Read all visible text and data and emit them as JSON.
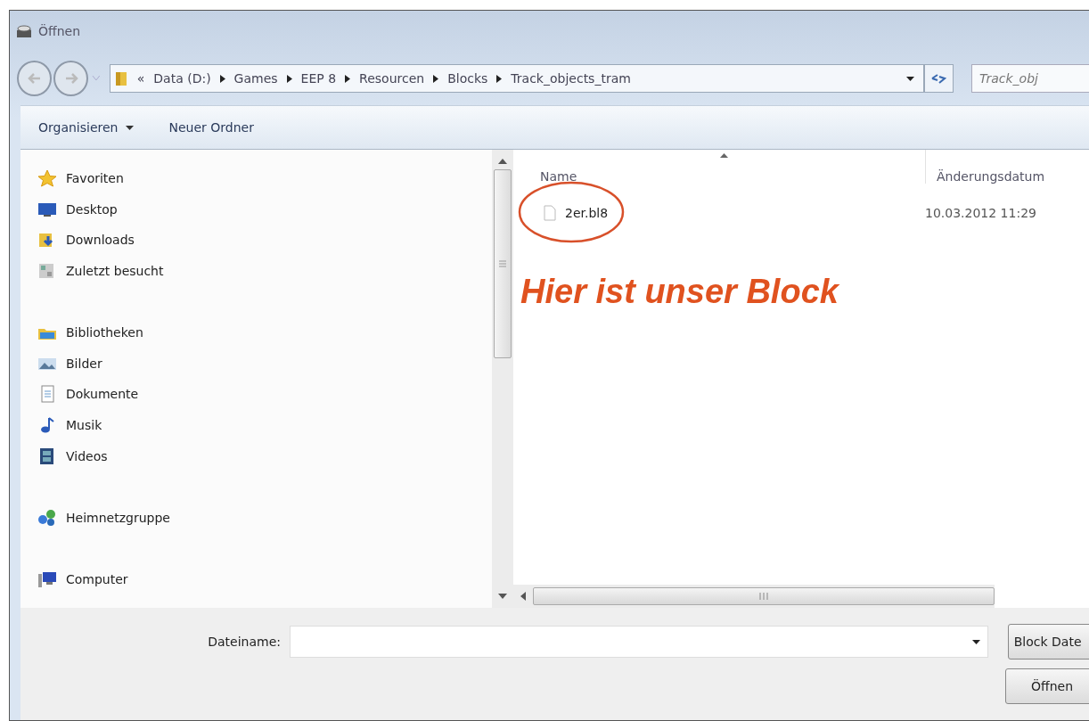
{
  "window": {
    "title": "Öffnen"
  },
  "breadcrumb": {
    "overflow": "«",
    "segments": [
      "Data (D:)",
      "Games",
      "EEP 8",
      "Resourcen",
      "Blocks",
      "Track_objects_tram"
    ]
  },
  "search": {
    "placeholder": "Track_obj"
  },
  "toolbar": [
    {
      "label": "Organisieren",
      "kind": "menu"
    },
    {
      "label": "Neuer Ordner",
      "kind": "button"
    }
  ],
  "nav": [
    {
      "label": "Favoriten",
      "kind": "star",
      "children": [
        {
          "label": "Desktop",
          "kind": "desktop"
        },
        {
          "label": "Downloads",
          "kind": "downloads"
        },
        {
          "label": "Zuletzt besucht",
          "kind": "recent"
        }
      ]
    },
    {
      "label": "Bibliotheken",
      "kind": "library",
      "children": [
        {
          "label": "Bilder",
          "kind": "pictures"
        },
        {
          "label": "Dokumente",
          "kind": "document"
        },
        {
          "label": "Musik",
          "kind": "music"
        },
        {
          "label": "Videos",
          "kind": "video"
        }
      ]
    },
    {
      "label": "Heimnetzgruppe",
      "kind": "homegroup"
    },
    {
      "label": "Computer",
      "kind": "computer"
    }
  ],
  "file_list": {
    "columns": [
      "Name",
      "Änderungsdatum"
    ],
    "rows": [
      {
        "name": "2er.bl8",
        "date": "10.03.2012 11:29"
      }
    ]
  },
  "annotation": "Hier ist unser Block",
  "filename": {
    "label": "Dateiname:"
  },
  "filetype": "Block Date",
  "buttons": [
    "Öffnen"
  ]
}
